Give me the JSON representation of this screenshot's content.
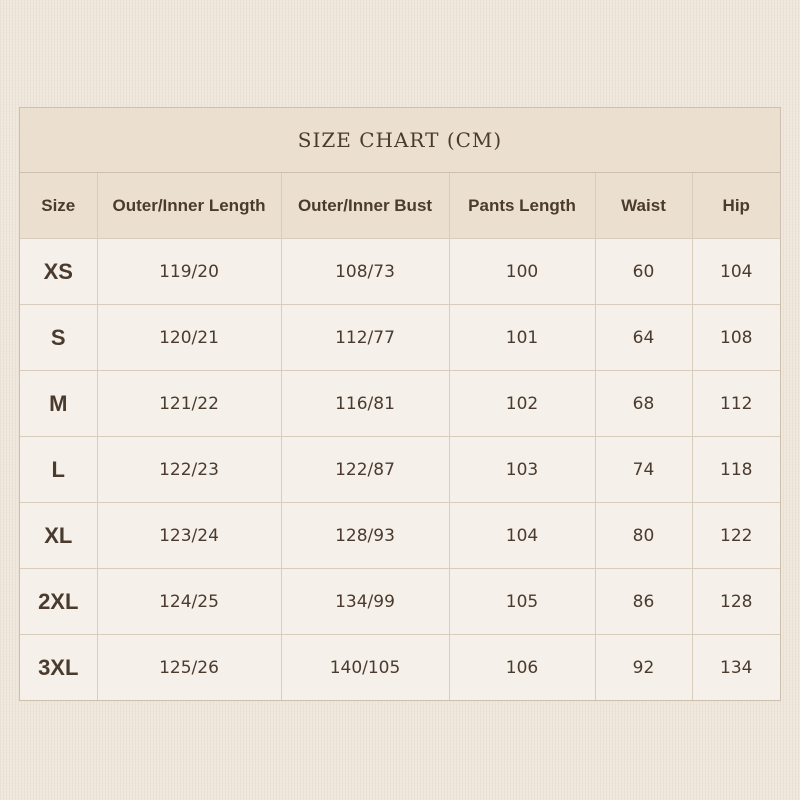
{
  "title": "SIZE CHART (CM)",
  "headers": [
    "Size",
    "Outer/Inner Length",
    "Outer/Inner Bust",
    "Pants Length",
    "Waist",
    "Hip"
  ],
  "rows": [
    [
      "XS",
      "119/20",
      "108/73",
      "100",
      "60",
      "104"
    ],
    [
      "S",
      "120/21",
      "112/77",
      "101",
      "64",
      "108"
    ],
    [
      "M",
      "121/22",
      "116/81",
      "102",
      "68",
      "112"
    ],
    [
      "L",
      "122/23",
      "122/87",
      "103",
      "74",
      "118"
    ],
    [
      "XL",
      "123/24",
      "128/93",
      "104",
      "80",
      "122"
    ],
    [
      "2XL",
      "124/25",
      "134/99",
      "105",
      "86",
      "128"
    ],
    [
      "3XL",
      "125/26",
      "140/105",
      "106",
      "92",
      "134"
    ]
  ],
  "colors": {
    "background": "#efe7dc",
    "header_fill": "#ebe0d0",
    "cell_fill": "#f5f0e9",
    "text": "#4a3b2e",
    "grid": "#d8ccbc"
  }
}
